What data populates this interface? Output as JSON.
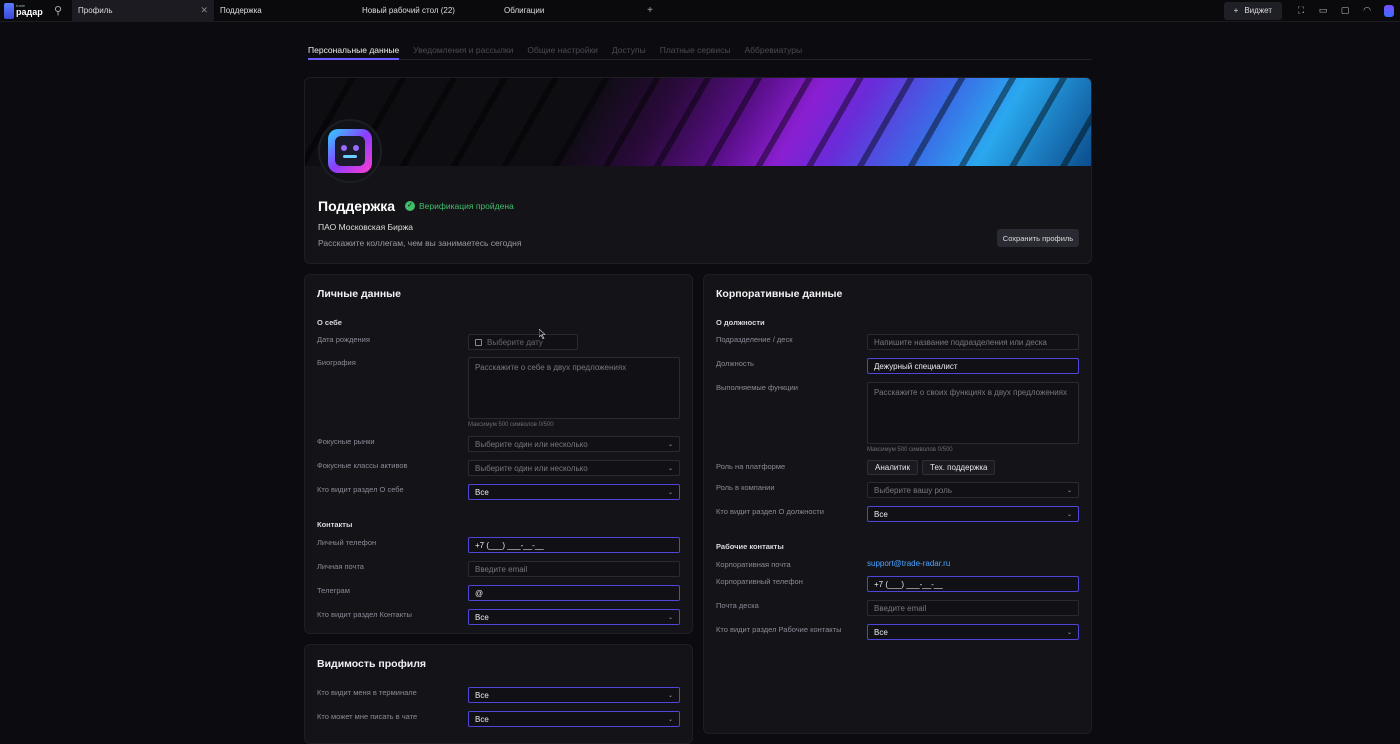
{
  "topbar": {
    "logo_small": "trade",
    "logo_big": "радар",
    "tabs": [
      {
        "label": "Профиль",
        "active": true
      },
      {
        "label": "Поддержка",
        "active": false
      },
      {
        "label": "Новый рабочий стол (22)",
        "active": false
      },
      {
        "label": "Облигации",
        "active": false
      }
    ],
    "widget_label": "Виджет"
  },
  "subtabs": [
    {
      "label": "Персональные данные",
      "active": true
    },
    {
      "label": "Уведомления и рассылки"
    },
    {
      "label": "Общие настройки"
    },
    {
      "label": "Доступы"
    },
    {
      "label": "Платные сервисы"
    },
    {
      "label": "Аббревиатуры"
    }
  ],
  "profile": {
    "name": "Поддержка",
    "verification": "Верификация пройдена",
    "organization": "ПАО Московская Биржа",
    "about_placeholder": "Расскажите коллегам, чем вы занимаетесь сегодня",
    "save_button": "Сохранить профиль",
    "colors": {
      "verified": "#3fbf6a",
      "accent": "#6a5cff"
    }
  },
  "personal": {
    "title": "Личные данные",
    "about_section": "О себе",
    "birthday_label": "Дата рождения",
    "birthday_placeholder": "Выберите дату",
    "bio_label": "Биография",
    "bio_placeholder": "Расскажите о себе в двух предложениях",
    "bio_hint": "Максимум 500 символов 0/500",
    "markets_label": "Фокусные рынки",
    "markets_placeholder": "Выберите один или несколько",
    "asset_classes_label": "Фокусные классы активов",
    "asset_classes_placeholder": "Выберите один или несколько",
    "about_visibility_label": "Кто видит раздел О себе",
    "about_visibility_value": "Все",
    "contacts_section": "Контакты",
    "phone_label": "Личный телефон",
    "phone_value": "+7 (___) ___-__-__",
    "email_label": "Личная почта",
    "email_placeholder": "Введите email",
    "telegram_label": "Телеграм",
    "telegram_value": "@",
    "contacts_visibility_label": "Кто видит раздел Контакты",
    "contacts_visibility_value": "Все"
  },
  "corporate": {
    "title": "Корпоративные данные",
    "position_section": "О должности",
    "department_label": "Подразделение / деск",
    "department_placeholder": "Напишите название подразделения или деска",
    "position_label": "Должность",
    "position_value": "Дежурный специалист",
    "functions_label": "Выполняемые функции",
    "functions_placeholder": "Расскажите о своих функциях в двух предложениях",
    "functions_hint": "Максимум 500 символов 0/500",
    "platform_role_label": "Роль на платформе",
    "platform_roles": [
      "Аналитик",
      "Тех. поддержка"
    ],
    "company_role_label": "Роль в компании",
    "company_role_placeholder": "Выберите вашу роль",
    "position_visibility_label": "Кто видит раздел О должности",
    "position_visibility_value": "Все",
    "work_contacts_section": "Рабочие контакты",
    "corp_email_label": "Корпоративная почта",
    "corp_email_value": "support@trade-radar.ru",
    "corp_phone_label": "Корпоративный телефон",
    "corp_phone_value": "+7 (___) ___-__-__",
    "desk_email_label": "Почта деска",
    "desk_email_placeholder": "Введите email",
    "work_contacts_visibility_label": "Кто видит раздел Рабочие контакты",
    "work_contacts_visibility_value": "Все"
  },
  "visibility": {
    "title": "Видимость профиля",
    "terminal_label": "Кто видит меня в терминале",
    "terminal_value": "Все",
    "chat_label": "Кто может мне писать в чате",
    "chat_value": "Все"
  }
}
